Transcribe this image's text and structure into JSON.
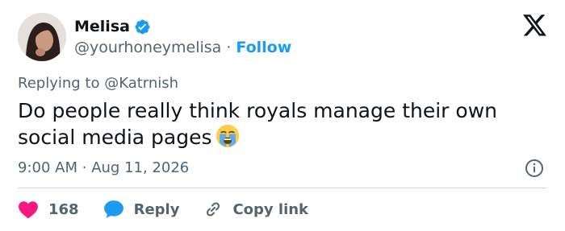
{
  "author": {
    "name": "Melisa",
    "handle": "@yourhoneymelisa",
    "separator": "·",
    "follow_label": "Follow"
  },
  "replying": {
    "prefix": "Replying to",
    "mention": "@Katrnish"
  },
  "tweet": {
    "text": "Do people really think royals manage their own social media pages",
    "emoji": "loudly-crying-face"
  },
  "meta": {
    "time": "9:00 AM",
    "separator": "·",
    "date": "Aug 11, 2026"
  },
  "actions": {
    "like_count": "168",
    "reply_label": "Reply",
    "copy_label": "Copy link"
  },
  "colors": {
    "accent": "#1d9bf0",
    "like": "#f91880",
    "muted": "#536471",
    "text": "#0f1419"
  },
  "icons": [
    "verified-badge-icon",
    "x-logo-icon",
    "info-icon",
    "heart-icon",
    "reply-bubble-icon",
    "link-icon"
  ]
}
